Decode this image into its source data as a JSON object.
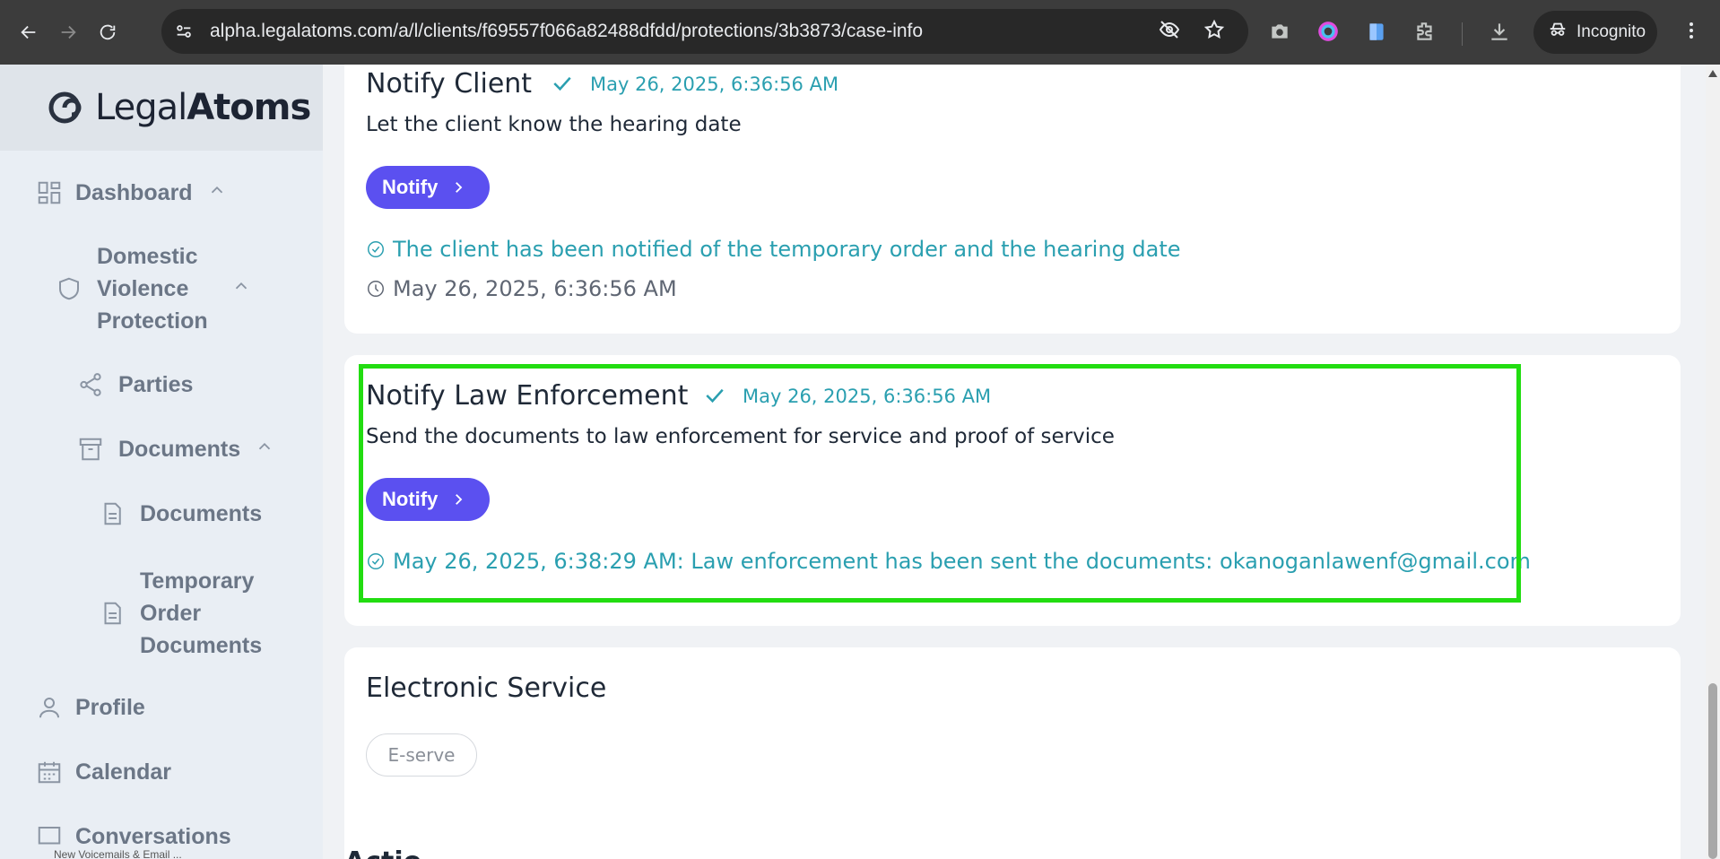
{
  "browser": {
    "url": "alpha.legalatoms.com/a/l/clients/f69557f066a82488dfdd/protections/3b3873/case-info",
    "profile_label": "Incognito"
  },
  "sidebar": {
    "logo_light": "Legal",
    "logo_bold": "Atoms",
    "items": [
      {
        "label": "Dashboard"
      },
      {
        "label": "Domestic Violence Protection"
      },
      {
        "label": "Parties"
      },
      {
        "label": "Documents"
      },
      {
        "label": "Documents"
      },
      {
        "label": "Temporary Order Documents"
      },
      {
        "label": "Profile"
      },
      {
        "label": "Calendar"
      },
      {
        "label": "Conversations"
      }
    ],
    "footer_text": "New Voicemails & Email ..."
  },
  "steps": {
    "notify_client": {
      "title": "Notify Client",
      "time": "May 26, 2025, 6:36:56 AM",
      "description": "Let the client know the hearing date",
      "button_label": "Notify",
      "status": "The client has been notified of the temporary order and the hearing date",
      "status_time": "May 26, 2025, 6:36:56 AM"
    },
    "notify_law": {
      "title": "Notify Law Enforcement",
      "time": "May 26, 2025, 6:36:56 AM",
      "description": "Send the documents to law enforcement for service and proof of service",
      "button_label": "Notify",
      "status": "May 26, 2025, 6:38:29 AM: Law enforcement has been sent the documents: okanoganlawenf@gmail.com"
    },
    "electronic_service": {
      "title": "Electronic Service",
      "button_label": "E-serve"
    },
    "next_title": "Actio"
  },
  "colors": {
    "accent": "#5b50f0",
    "teal": "#2a9fb0",
    "highlight": "#22dd11"
  }
}
